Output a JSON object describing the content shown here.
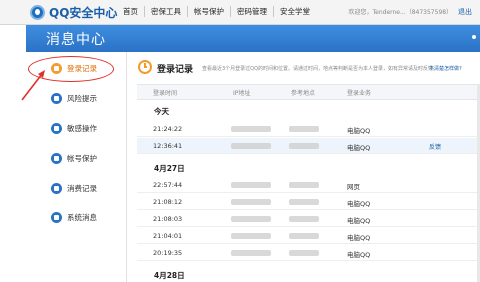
{
  "header": {
    "logo_text": "QQ安全中心",
    "nav": [
      "首页",
      "密保工具",
      "帐号保护",
      "密码管理",
      "安全学堂"
    ],
    "user_greeting": "欢迎您，Tenderne...（847357598）",
    "logout": "退出"
  },
  "titlebar": {
    "title": "消息中心"
  },
  "sidebar": {
    "items": [
      {
        "label": "登录记录",
        "icon": "clock-icon",
        "active": true
      },
      {
        "label": "风险提示",
        "icon": "alert-icon",
        "active": false
      },
      {
        "label": "敏感操作",
        "icon": "shield-icon",
        "active": false
      },
      {
        "label": "帐号保护",
        "icon": "lock-icon",
        "active": false
      },
      {
        "label": "消费记录",
        "icon": "receipt-icon",
        "active": false
      },
      {
        "label": "系统消息",
        "icon": "info-icon",
        "active": false
      }
    ]
  },
  "main": {
    "section_title": "登录记录",
    "section_desc": "查看最近3个月登录过QQ的时间和位置。请通过时间，地点等判断是否为本人登录，如有异常请及时反馈。",
    "section_link": "不清楚怎样做?",
    "columns": [
      "登录时间",
      "IP地址",
      "参考地点",
      "登录业务"
    ],
    "groups": [
      {
        "label": "今天",
        "rows": [
          {
            "time": "21:24:22",
            "service": "电脑QQ",
            "feedback": ""
          },
          {
            "time": "12:36:41",
            "service": "电脑QQ",
            "feedback": "反馈"
          }
        ]
      },
      {
        "label": "4月27日",
        "rows": [
          {
            "time": "22:57:44",
            "service": "网页",
            "feedback": ""
          },
          {
            "time": "21:08:12",
            "service": "电脑QQ",
            "feedback": ""
          },
          {
            "time": "21:08:03",
            "service": "电脑QQ",
            "feedback": ""
          },
          {
            "time": "21:04:01",
            "service": "电脑QQ",
            "feedback": ""
          },
          {
            "time": "20:19:35",
            "service": "电脑QQ",
            "feedback": ""
          }
        ]
      },
      {
        "label": "4月28日",
        "rows": []
      }
    ]
  },
  "colors": {
    "brand_blue": "#2a72c6",
    "accent_orange": "#f39b2e",
    "annotation_red": "#e0302a"
  }
}
